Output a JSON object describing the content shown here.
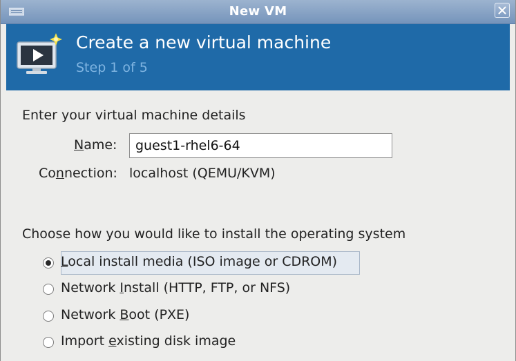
{
  "window": {
    "title": "New VM"
  },
  "banner": {
    "title": "Create a new virtual machine",
    "step": "Step 1 of 5"
  },
  "details": {
    "heading": "Enter your virtual machine details",
    "name_label_underlined": "N",
    "name_label_rest": "ame:",
    "name_value": "guest1-rhel6-64",
    "connection_label_pre": "Co",
    "connection_label_underlined": "n",
    "connection_label_post": "nection:",
    "connection_value": "localhost (QEMU/KVM)"
  },
  "install": {
    "heading": "Choose how you would like to install the operating system",
    "options": [
      {
        "pre": "",
        "underlined": "L",
        "post": "ocal install media (ISO image or CDROM)",
        "selected": true
      },
      {
        "pre": "Network ",
        "underlined": "I",
        "post": "nstall (HTTP, FTP, or NFS)",
        "selected": false
      },
      {
        "pre": "Network ",
        "underlined": "B",
        "post": "oot (PXE)",
        "selected": false
      },
      {
        "pre": "Import ",
        "underlined": "e",
        "post": "xisting disk image",
        "selected": false
      }
    ]
  },
  "colors": {
    "banner": "#1f6aa8",
    "titlebar": "#7594bb",
    "step_text": "#7fb4e1"
  }
}
